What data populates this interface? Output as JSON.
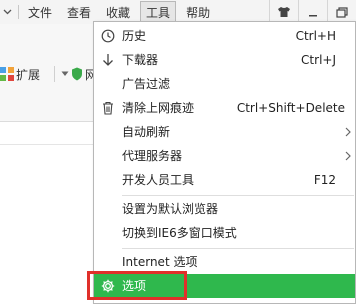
{
  "menubar": {
    "items": [
      {
        "label": "文件"
      },
      {
        "label": "查看"
      },
      {
        "label": "收藏"
      },
      {
        "label": "工具"
      },
      {
        "label": "帮助"
      }
    ]
  },
  "toolbar": {
    "extensions_label": "扩展",
    "truncated_label": "网"
  },
  "tools_menu": {
    "items": [
      {
        "label": "历史",
        "shortcut": "Ctrl+H",
        "icon": "clock-icon"
      },
      {
        "label": "下载器",
        "shortcut": "Ctrl+J",
        "icon": "download-arrow-icon"
      },
      {
        "label": "广告过滤",
        "shortcut": "",
        "icon": ""
      },
      {
        "label": "清除上网痕迹",
        "shortcut": "Ctrl+Shift+Delete",
        "icon": "trash-icon"
      },
      {
        "label": "自动刷新",
        "shortcut": "",
        "icon": "",
        "submenu": true
      },
      {
        "label": "代理服务器",
        "shortcut": "",
        "icon": "",
        "submenu": true
      },
      {
        "label": "开发人员工具",
        "shortcut": "F12",
        "icon": ""
      },
      {
        "label": "设置为默认浏览器",
        "shortcut": "",
        "icon": ""
      },
      {
        "label": "切换到IE6多窗口模式",
        "shortcut": "",
        "icon": ""
      },
      {
        "label": "Internet 选项",
        "shortcut": "",
        "icon": ""
      },
      {
        "label": "选项",
        "shortcut": "",
        "icon": "gear-icon"
      }
    ]
  },
  "colors": {
    "selected_background": "#2fb84d",
    "highlight_border": "#e0302a"
  }
}
